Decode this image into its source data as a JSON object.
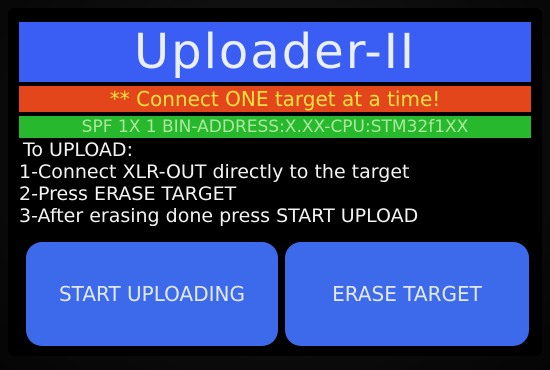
{
  "app": {
    "title": "Uploader-II"
  },
  "warning": {
    "text": "** Connect ONE target at a time!"
  },
  "info": {
    "text": "SPF 1X 1 BIN-ADDRESS:X.XX-CPU:STM32f1XX"
  },
  "instructions": {
    "heading": "To UPLOAD:",
    "steps": [
      "1-Connect XLR-OUT directly to the target",
      "2-Press ERASE TARGET",
      "3-After erasing done press START UPLOAD"
    ]
  },
  "buttons": {
    "start_label": "START UPLOADING",
    "erase_label": "ERASE TARGET"
  },
  "colors": {
    "title_bg": "#3a5ef3",
    "warning_bg": "#e2461a",
    "warning_text": "#f7e042",
    "info_bg": "#27b82e",
    "button_bg": "#3d6aea",
    "screen_bg": "#000000"
  }
}
